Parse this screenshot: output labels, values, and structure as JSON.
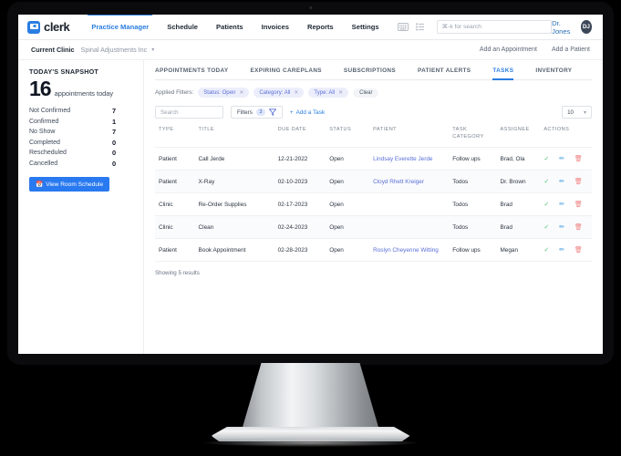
{
  "header": {
    "logo_text": "clerk",
    "logo_icon": "monitor-plus-icon",
    "nav": [
      {
        "label": "Practice Manager",
        "active": true
      },
      {
        "label": "Schedule",
        "active": false
      },
      {
        "label": "Patients",
        "active": false
      },
      {
        "label": "Invoices",
        "active": false
      },
      {
        "label": "Reports",
        "active": false
      },
      {
        "label": "Settings",
        "active": false
      }
    ],
    "icons": [
      "keyboard-icon",
      "list-icon"
    ],
    "search_placeholder": "⌘-k for search",
    "search_value": "",
    "profile_name": "Dr. Jones",
    "avatar_initials": "DJ"
  },
  "clinicbar": {
    "label": "Current Clinic",
    "value": "Spinal Adjustments Inc",
    "actions": [
      {
        "label": "Add an Appointment"
      },
      {
        "label": "Add a Patient"
      }
    ]
  },
  "sidebar": {
    "title": "TODAY'S SNAPSHOT",
    "count": "16",
    "count_sub": "appointments today",
    "stats": [
      {
        "label": "Not Confirmed",
        "value": "7"
      },
      {
        "label": "Confirmed",
        "value": "1"
      },
      {
        "label": "No Show",
        "value": "7"
      },
      {
        "label": "Completed",
        "value": "0"
      },
      {
        "label": "Rescheduled",
        "value": "0"
      },
      {
        "label": "Cancelled",
        "value": "0"
      }
    ],
    "room_button": "View Room Schedule"
  },
  "tabs": [
    {
      "label": "APPOINTMENTS TODAY",
      "active": false
    },
    {
      "label": "EXPIRING CAREPLANS",
      "active": false
    },
    {
      "label": "SUBSCRIPTIONS",
      "active": false
    },
    {
      "label": "PATIENT ALERTS",
      "active": false
    },
    {
      "label": "TASKS",
      "active": true
    },
    {
      "label": "INVENTORY",
      "active": false
    }
  ],
  "filters": {
    "applied_label": "Applied Filters:",
    "chips": [
      {
        "label": "Status: Open"
      },
      {
        "label": "Category: All"
      },
      {
        "label": "Type: All"
      }
    ],
    "clear_label": "Clear"
  },
  "toolbar": {
    "search_placeholder": "Search",
    "search_value": "",
    "filters_label": "Filters",
    "filters_count": "3",
    "add_task_label": "Add a Task",
    "page_size": "10"
  },
  "table": {
    "columns": [
      "TYPE",
      "TITLE",
      "DUE DATE",
      "STATUS",
      "PATIENT",
      "TASK CATEGORY",
      "ASSIGNEE",
      "ACTIONS"
    ],
    "rows": [
      {
        "type": "Patient",
        "title": "Call Jerde",
        "due_date": "12-21-2022",
        "status": "Open",
        "patient": "Lindsay Everette Jerde",
        "category": "Follow ups",
        "assignee": "Brad, Ola"
      },
      {
        "type": "Patient",
        "title": "X-Ray",
        "due_date": "02-10-2023",
        "status": "Open",
        "patient": "Cloyd Rhett Kreiger",
        "category": "Todos",
        "assignee": "Dr. Brown"
      },
      {
        "type": "Clinic",
        "title": "Re-Order Supplies",
        "due_date": "02-17-2023",
        "status": "Open",
        "patient": "",
        "category": "Todos",
        "assignee": "Brad"
      },
      {
        "type": "Clinic",
        "title": "Clean",
        "due_date": "02-24-2023",
        "status": "Open",
        "patient": "",
        "category": "Todos",
        "assignee": "Brad"
      },
      {
        "type": "Patient",
        "title": "Book Appointment",
        "due_date": "02-28-2023",
        "status": "Open",
        "patient": "Roslyn Cheyenne Witting",
        "category": "Follow ups",
        "assignee": "Megan"
      }
    ],
    "action_icons": [
      "complete-check-icon",
      "edit-icon",
      "delete-icon"
    ],
    "showing": "Showing 5 results"
  },
  "colors": {
    "accent": "#2a7de1",
    "button": "#2979f0",
    "link": "#5a6fd8",
    "check": "#4fc47c",
    "edit": "#3d9ae0",
    "trash": "#f08080"
  }
}
